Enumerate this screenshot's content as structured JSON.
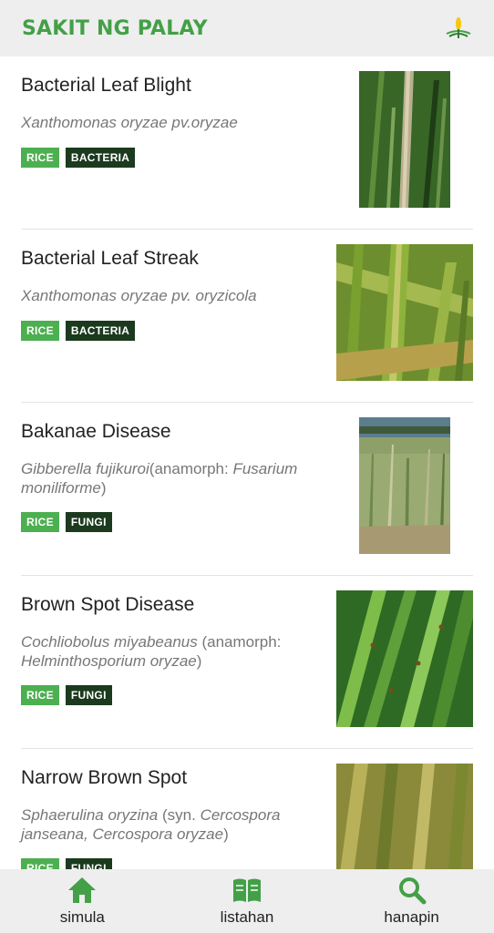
{
  "app_bar": {
    "title": "SAKIT NG PALAY",
    "logo_icon": "rice-plant-icon"
  },
  "diseases": [
    {
      "name": "Bacterial Leaf Blight",
      "sci_italic": "Xanthomonas oryzae pv.oryzae",
      "sci_rest": "",
      "tags": [
        "RICE",
        "BACTERIA"
      ]
    },
    {
      "name": "Bacterial Leaf Streak",
      "sci_italic": "Xanthomonas oryzae pv. oryzicola",
      "sci_rest": "",
      "tags": [
        "RICE",
        "BACTERIA"
      ]
    },
    {
      "name": "Bakanae Disease",
      "sci_italic": "Gibberella fujikuroi",
      "sci_mid": "(anamorph: ",
      "sci_italic2": "Fusarium moniliforme",
      "sci_end": ")",
      "tags": [
        "RICE",
        "FUNGI"
      ]
    },
    {
      "name": "Brown Spot Disease",
      "sci_italic": "Cochliobolus miyabeanus",
      "sci_mid": " (anamorph: ",
      "sci_italic2": "Helminthosporium oryzae",
      "sci_end": ")",
      "tags": [
        "RICE",
        "FUNGI"
      ]
    },
    {
      "name": "Narrow Brown Spot",
      "sci_italic": "Sphaerulina oryzina",
      "sci_mid": " (syn. ",
      "sci_italic2": "Cercospora janseana, Cercospora oryzae",
      "sci_end": ")",
      "tags": [
        "RICE",
        "FUNGI"
      ]
    }
  ],
  "bottom_nav": [
    {
      "label": "simula",
      "icon": "home-icon"
    },
    {
      "label": "listahan",
      "icon": "book-icon"
    },
    {
      "label": "hanapin",
      "icon": "search-icon"
    }
  ],
  "colors": {
    "accent": "#43a047",
    "tag_rice": "#4caf50",
    "tag_type": "#1b3a1e",
    "bar_bg": "#eeeeee"
  }
}
